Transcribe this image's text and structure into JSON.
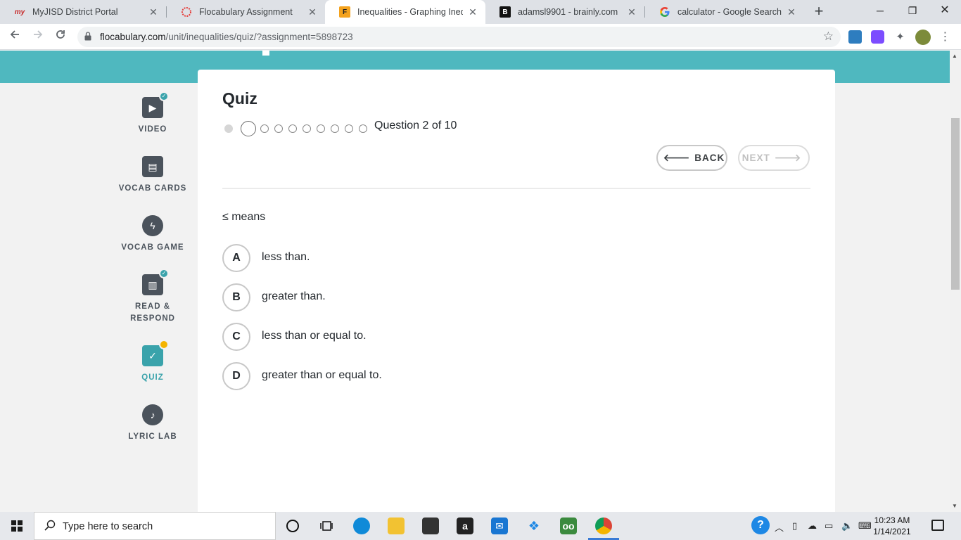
{
  "browser": {
    "tabs": [
      {
        "title": "MyJISD District Portal",
        "icon": "myjisd-icon",
        "active": false
      },
      {
        "title": "Flocabulary Assignment",
        "icon": "flocabulary-ring-icon",
        "active": false
      },
      {
        "title": "Inequalities - Graphing Inequa",
        "icon": "flocabulary-f-icon",
        "active": true
      },
      {
        "title": "adamsl9901 - brainly.com",
        "icon": "brainly-icon",
        "active": false
      },
      {
        "title": "calculator - Google Search",
        "icon": "google-icon",
        "active": false
      }
    ],
    "url_host": "flocabulary.com",
    "url_path": "/unit/inequalities/quiz/?assignment=5898723"
  },
  "sidenav": {
    "items": [
      {
        "label": "VIDEO",
        "icon": "video-icon",
        "status": "done"
      },
      {
        "label": "VOCAB CARDS",
        "icon": "vocab-cards-icon",
        "status": "none"
      },
      {
        "label": "VOCAB GAME",
        "icon": "lightning-icon",
        "status": "none"
      },
      {
        "label": "READ &",
        "label2": "RESPOND",
        "icon": "book-icon",
        "status": "done"
      },
      {
        "label": "QUIZ",
        "icon": "quiz-icon",
        "status": "pending",
        "active": true
      },
      {
        "label": "LYRIC LAB",
        "icon": "music-note-icon",
        "status": "none"
      }
    ]
  },
  "quiz": {
    "title": "Quiz",
    "progress_text": "Question 2 of 10",
    "current_question": 2,
    "total_questions": 10,
    "back_label": "BACK",
    "next_label": "NEXT",
    "question": "≤ means",
    "choices": [
      {
        "letter": "A",
        "text": "less than."
      },
      {
        "letter": "B",
        "text": "greater than."
      },
      {
        "letter": "C",
        "text": "less than or equal to."
      },
      {
        "letter": "D",
        "text": "greater than or equal to."
      }
    ]
  },
  "taskbar": {
    "search_placeholder": "Type here to search",
    "time": "10:23 AM",
    "date": "1/14/2021"
  },
  "colors": {
    "accent": "#3aa3ab",
    "hero": "#4fb8bf",
    "badge_pending": "#f4b400"
  }
}
